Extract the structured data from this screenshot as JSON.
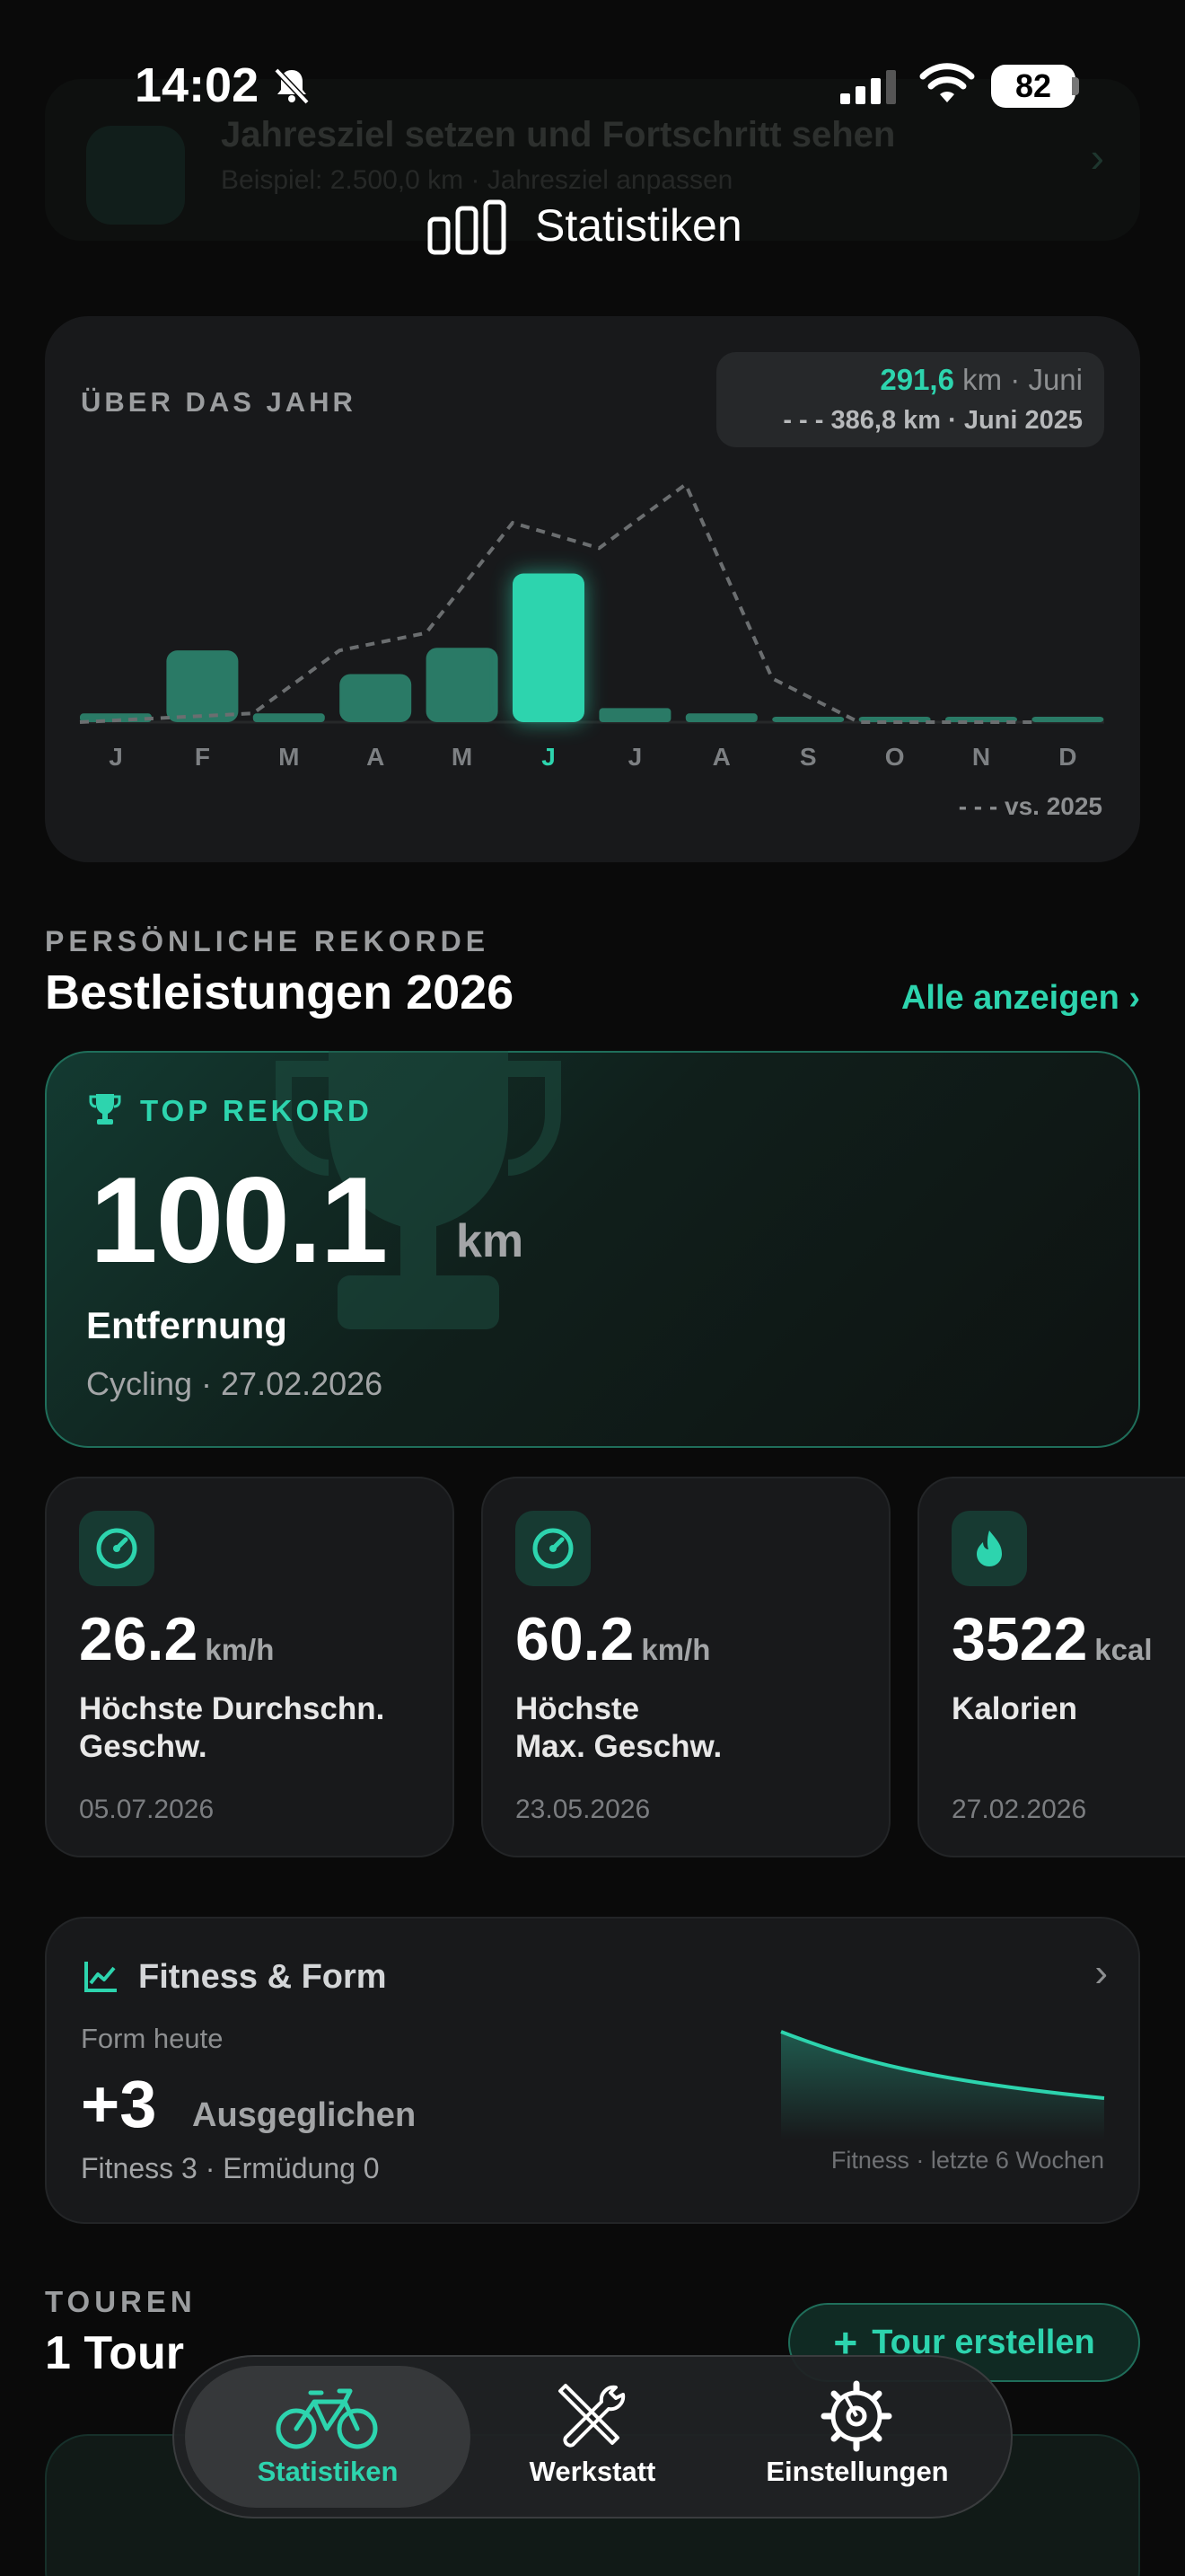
{
  "status_bar": {
    "time": "14:02",
    "battery": "82"
  },
  "background_banner": {
    "title": "Jahresziel setzen und Fortschritt sehen",
    "subtitle": "Beispiel: 2.500,0 km · Jahresziel anpassen"
  },
  "header": {
    "title": "Statistiken"
  },
  "year_card": {
    "label": "ÜBER DAS JAHR",
    "current_value": "291,6",
    "current_suffix": " km · Juni",
    "compare_text": "386,8 km · Juni 2025",
    "compare_legend": "vs. 2025"
  },
  "chart_data": {
    "type": "bar",
    "categories": [
      "J",
      "F",
      "M",
      "A",
      "M",
      "J",
      "J",
      "A",
      "S",
      "O",
      "N",
      "D"
    ],
    "series": [
      {
        "values": [
          10,
          82,
          10,
          55,
          85,
          170,
          16,
          10,
          0,
          0,
          0,
          0
        ]
      },
      {
        "values": [
          0,
          5,
          10,
          82,
          102,
          228,
          199,
          272,
          50,
          0,
          0,
          0
        ]
      }
    ],
    "highlight_index": 5,
    "ylim": [
      0,
      300
    ],
    "colors": {
      "bar": "#2a7a66",
      "highlight": "#2dd4ae",
      "compare_line": "#6b6e70"
    }
  },
  "records": {
    "eyebrow": "PERSÖNLICHE REKORDE",
    "title": "Bestleistungen 2026",
    "show_all": "Alle anzeigen ›",
    "top": {
      "tag": "TOP REKORD",
      "value": "100.1",
      "unit": "km",
      "name": "Entfernung",
      "sub": "Cycling · 27.02.2026"
    },
    "cards": [
      {
        "icon": "speedometer-icon",
        "value": "26.2",
        "unit": "km/h",
        "name": "Höchste Durchschn.\nGeschw.",
        "date": "05.07.2026"
      },
      {
        "icon": "speedometer-icon",
        "value": "60.2",
        "unit": "km/h",
        "name": "Höchste\nMax. Geschw.",
        "date": "23.05.2026"
      },
      {
        "icon": "flame-icon",
        "value": "3522",
        "unit": "kcal",
        "name": "Kalorien",
        "date": "27.02.2026"
      }
    ]
  },
  "fitness": {
    "title": "Fitness & Form",
    "sub": "Form heute",
    "value": "+3",
    "state": "Ausgeglichen",
    "line": "Fitness 3 · Ermüdung 0",
    "caption": "Fitness · letzte 6 Wochen"
  },
  "tours": {
    "eyebrow": "TOUREN",
    "count": "1 Tour",
    "create_label": "Tour erstellen"
  },
  "tabbar": {
    "tabs": [
      {
        "label": "Statistiken",
        "active": true
      },
      {
        "label": "Werkstatt",
        "active": false
      },
      {
        "label": "Einstellungen",
        "active": false
      }
    ]
  },
  "colors": {
    "accent": "#2dd4ae",
    "background": "#0a0a0a",
    "card": "#18191b"
  }
}
